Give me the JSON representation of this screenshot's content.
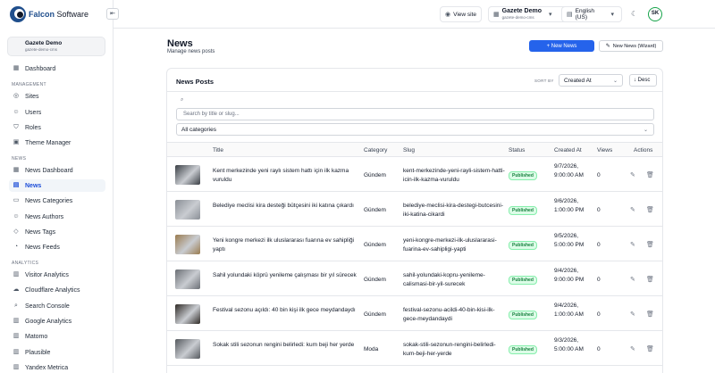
{
  "brand": {
    "name_bold": "Falcon",
    "name_rest": " Software"
  },
  "tenant": {
    "name": "Gazete Demo",
    "sub": "gazete-demo-cms"
  },
  "sidebar": {
    "sections": [
      {
        "label": "MANAGEMENT"
      },
      {
        "label": "NEWS"
      },
      {
        "label": "ANALYTICS"
      }
    ],
    "items": [
      {
        "label": "Dashboard",
        "icon": "grid-icon"
      },
      {
        "label": "Sites",
        "icon": "globe-icon"
      },
      {
        "label": "Users",
        "icon": "users-icon"
      },
      {
        "label": "Roles",
        "icon": "shield-icon"
      },
      {
        "label": "Theme Manager",
        "icon": "palette-icon"
      },
      {
        "label": "News Dashboard",
        "icon": "grid-icon"
      },
      {
        "label": "News",
        "icon": "newspaper-icon",
        "active": true
      },
      {
        "label": "News Categories",
        "icon": "folder-icon"
      },
      {
        "label": "News Authors",
        "icon": "user-icon"
      },
      {
        "label": "News Tags",
        "icon": "tag-icon"
      },
      {
        "label": "News Feeds",
        "icon": "rss-icon"
      },
      {
        "label": "Visitor Analytics",
        "icon": "chart-icon"
      },
      {
        "label": "Cloudflare Analytics",
        "icon": "cloud-icon"
      },
      {
        "label": "Search Console",
        "icon": "search-icon"
      },
      {
        "label": "Google Analytics",
        "icon": "chart-icon"
      },
      {
        "label": "Matomo",
        "icon": "chart-icon"
      },
      {
        "label": "Plausible",
        "icon": "chart-icon"
      },
      {
        "label": "Yandex Metrica",
        "icon": "chart-icon"
      }
    ]
  },
  "header": {
    "view_site": "View site",
    "tenant_name": "Gazete Demo",
    "tenant_sub": "gazete-demo-cms",
    "language": "English (US)",
    "avatar": "SK"
  },
  "page": {
    "title": "News",
    "subtitle": "Manage news posts",
    "new_button": "+ New News",
    "wizard_button": "New News (Wizard)"
  },
  "card": {
    "title": "News Posts",
    "sort_label": "SORT BY",
    "sort_value": "Created At",
    "direction": "Desc",
    "search_placeholder": "Search by title or slug...",
    "category_filter": "All categories"
  },
  "table": {
    "columns": [
      "Title",
      "Category",
      "Slug",
      "Status",
      "Created At",
      "Views",
      "Actions"
    ],
    "rows": [
      {
        "title": "Kent merkezinde yeni raylı sistem hattı için ilk kazma vuruldu",
        "category": "Gündem",
        "slug": "kent-merkezinde-yeni-rayli-sistem-hatti-icin-ilk-kazma-vuruldu",
        "status": "Published",
        "created": "9/7/2026, 9:00:00 AM",
        "views": "0",
        "thumb": "#3a3f45"
      },
      {
        "title": "Belediye meclisi kira desteği bütçesini iki katına çıkardı",
        "category": "Gündem",
        "slug": "belediye-meclisi-kira-destegi-butcesini-iki-katina-cikardi",
        "status": "Published",
        "created": "9/6/2026, 1:00:00 PM",
        "views": "0",
        "thumb": "#8a8f96"
      },
      {
        "title": "Yeni kongre merkezi ilk uluslararası fuarına ev sahipliği yaptı",
        "category": "Gündem",
        "slug": "yeni-kongre-merkezi-ilk-uluslararasi-fuarina-ev-sahipligi-yapti",
        "status": "Published",
        "created": "9/5/2026, 5:00:00 PM",
        "views": "0",
        "thumb": "#9a7b4f"
      },
      {
        "title": "Sahil yolundaki köprü yenileme çalışması bir yıl sürecek",
        "category": "Gündem",
        "slug": "sahil-yolundaki-kopru-yenileme-calismasi-bir-yil-surecek",
        "status": "Published",
        "created": "9/4/2026, 9:00:00 PM",
        "views": "0",
        "thumb": "#6b6f75"
      },
      {
        "title": "Festival sezonu açıldı: 40 bin kişi ilk gece meydandaydı",
        "category": "Gündem",
        "slug": "festival-sezonu-acildi-40-bin-kisi-ilk-gece-meydandaydi",
        "status": "Published",
        "created": "9/4/2026, 1:00:00 AM",
        "views": "0",
        "thumb": "#2f2a26"
      },
      {
        "title": "Sokak stili sezonun rengini belirledi: kum beji her yerde",
        "category": "Moda",
        "slug": "sokak-stili-sezonun-rengini-belirledi-kum-beji-her-yerde",
        "status": "Published",
        "created": "9/3/2026, 5:00:00 AM",
        "views": "0",
        "thumb": "#55595e"
      }
    ]
  }
}
